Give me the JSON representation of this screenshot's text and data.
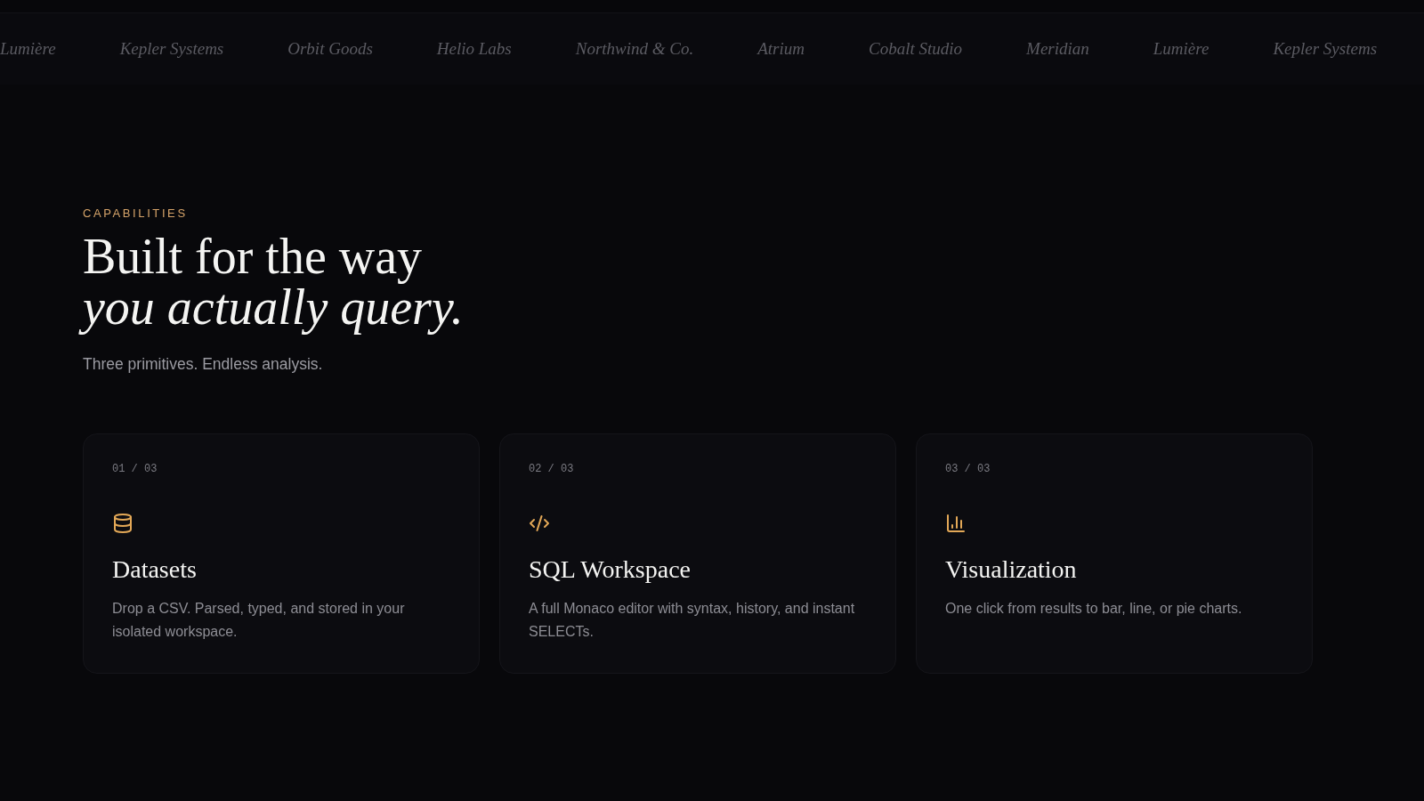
{
  "logo_strip": {
    "logos": [
      "Lumière",
      "Kepler Systems",
      "Orbit Goods",
      "Helio Labs",
      "Northwind & Co.",
      "Atrium",
      "Cobalt Studio",
      "Meridian",
      "Lumière",
      "Kepler Systems"
    ]
  },
  "section": {
    "eyebrow": "CAPABILITIES",
    "heading": "Built for the way *you actually query.*",
    "subtitle": "Three primitives. Endless analysis."
  },
  "cards": [
    {
      "counter": "01 / 03",
      "title": "Datasets",
      "description": "Drop a CSV. Parsed, typed, and stored in your isolated workspace."
    },
    {
      "counter": "02 / 03",
      "title": "SQL Workspace",
      "description": "A full Monaco editor with syntax, history, and instant SELECTs."
    },
    {
      "counter": "03 / 03",
      "title": "Visualization",
      "description": "One click from results to bar, line, or pie charts."
    }
  ]
}
